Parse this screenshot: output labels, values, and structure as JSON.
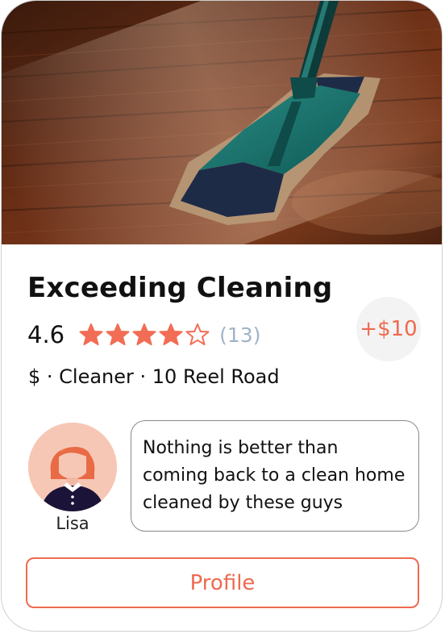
{
  "card": {
    "image_description_icon": "mop-photo",
    "title": "Exceeding Cleaning",
    "rating": "4.6",
    "stars_filled": 4,
    "stars_total": 5,
    "review_count": "(13)",
    "bonus": "+$10",
    "meta": "$ · Cleaner · 10 Reel Road",
    "reviewer": {
      "name": "Lisa",
      "quote": "Nothing is better than coming back to a clean home cleaned by these guys"
    },
    "profile_button": "Profile"
  },
  "colors": {
    "accent": "#ee6a4f",
    "star": "#f26d55",
    "count": "#9fb4c7",
    "bonus_bg": "#f3f3f3"
  }
}
